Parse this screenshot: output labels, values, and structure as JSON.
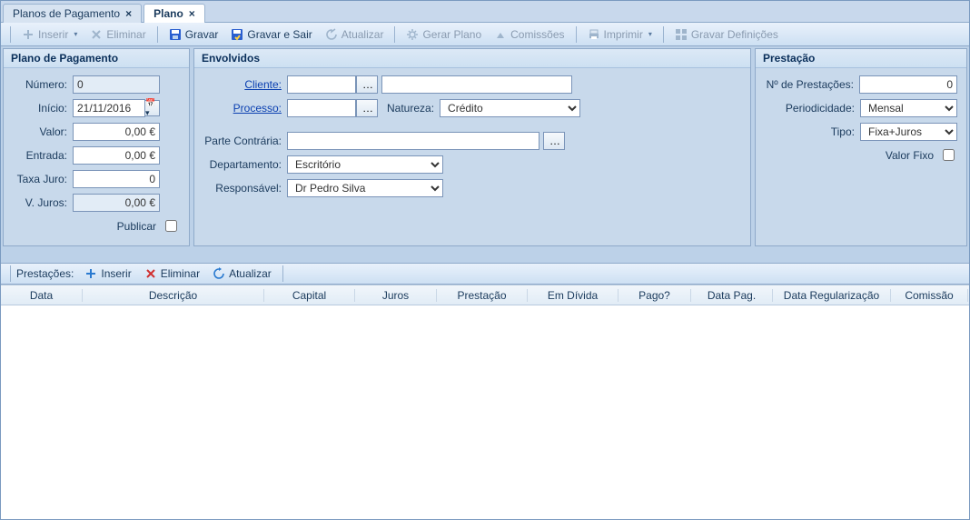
{
  "tabs": [
    {
      "label": "Planos de Pagamento",
      "active": false
    },
    {
      "label": "Plano",
      "active": true
    }
  ],
  "toolbar": {
    "inserir": "Inserir",
    "eliminar": "Eliminar",
    "gravar": "Gravar",
    "gravar_sair": "Gravar e Sair",
    "atualizar": "Atualizar",
    "gerar_plano": "Gerar Plano",
    "comissoes": "Comissões",
    "imprimir": "Imprimir",
    "gravar_def": "Gravar Definições"
  },
  "plano": {
    "title": "Plano de Pagamento",
    "numero_lbl": "Número:",
    "numero": "0",
    "inicio_lbl": "Início:",
    "inicio": "21/11/2016",
    "valor_lbl": "Valor:",
    "valor": "0,00 €",
    "entrada_lbl": "Entrada:",
    "entrada": "0,00 €",
    "taxa_lbl": "Taxa Juro:",
    "taxa": "0",
    "vjuros_lbl": "V. Juros:",
    "vjuros": "0,00 €",
    "publicar_lbl": "Publicar"
  },
  "envolvidos": {
    "title": "Envolvidos",
    "cliente_lbl": "Cliente:",
    "processo_lbl": "Processo:",
    "natureza_lbl": "Natureza:",
    "natureza": "Crédito",
    "parte_lbl": "Parte Contrária:",
    "departamento_lbl": "Departamento:",
    "departamento": "Escritório",
    "responsavel_lbl": "Responsável:",
    "responsavel": "Dr Pedro Silva"
  },
  "prestacao": {
    "title": "Prestação",
    "nprest_lbl": "Nº de Prestações:",
    "nprest": "0",
    "period_lbl": "Periodicidade:",
    "period": "Mensal",
    "tipo_lbl": "Tipo:",
    "tipo": "Fixa+Juros",
    "valorfixo_lbl": "Valor Fixo"
  },
  "sub": {
    "prestacoes_lbl": "Prestações:",
    "inserir": "Inserir",
    "eliminar": "Eliminar",
    "atualizar": "Atualizar"
  },
  "grid": {
    "cols": [
      "Data",
      "Descrição",
      "Capital",
      "Juros",
      "Prestação",
      "Em Dívida",
      "Pago?",
      "Data Pag.",
      "Data Regularização",
      "Comissão"
    ],
    "widths": [
      90,
      200,
      100,
      90,
      100,
      100,
      80,
      90,
      130,
      85
    ]
  }
}
